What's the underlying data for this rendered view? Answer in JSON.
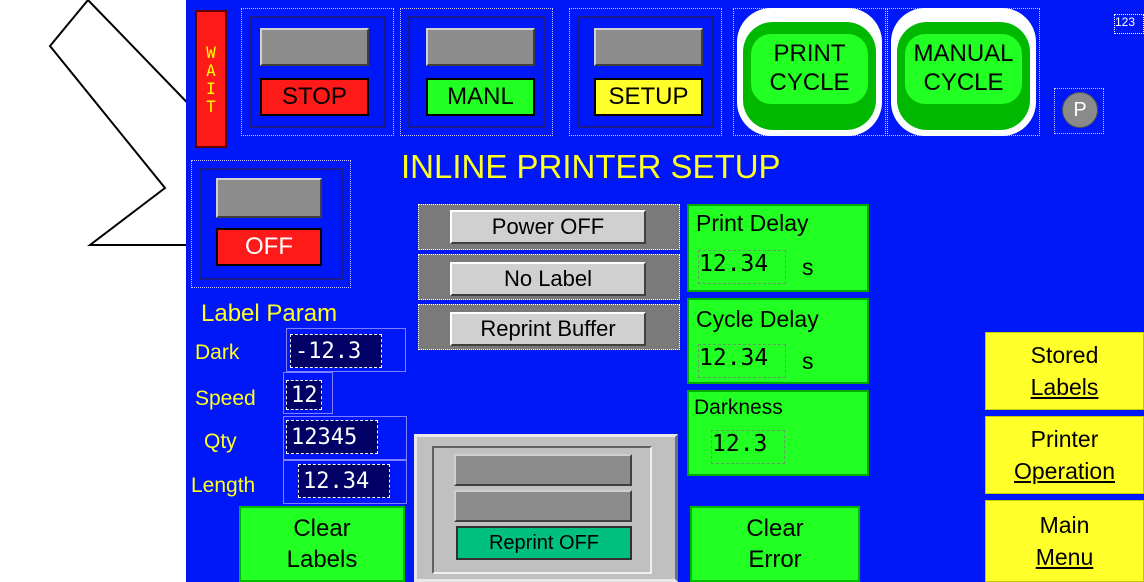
{
  "wait_label": "WAIT",
  "top_buttons": {
    "stop": "STOP",
    "manual": "MANL",
    "setup": "SETUP"
  },
  "print_cycle": {
    "line1": "PRINT",
    "line2": "CYCLE"
  },
  "manual_cycle": {
    "line1": "MANUAL",
    "line2": "CYCLE"
  },
  "p_badge": "P",
  "corner_number": "123",
  "title": "INLINE PRINTER SETUP",
  "off_label": "OFF",
  "buttons": {
    "power": "Power OFF",
    "no_label": "No Label",
    "reprint_buffer": "Reprint Buffer"
  },
  "print_delay": {
    "label": "Print Delay",
    "value": "12.34",
    "unit": "s"
  },
  "cycle_delay": {
    "label": "Cycle Delay",
    "value": "12.34",
    "unit": "s"
  },
  "darkness": {
    "label": "Darkness",
    "value": "12.3"
  },
  "label_param": {
    "title": "Label Param",
    "dark": {
      "label": "Dark",
      "value": "-12.3"
    },
    "speed": {
      "label": "Speed",
      "value": "12"
    },
    "qty": {
      "label": "Qty",
      "value": "12345"
    },
    "length": {
      "label": "Length",
      "value": "12.34"
    }
  },
  "clear_labels": {
    "line1": "Clear",
    "line2": "Labels"
  },
  "clear_error": {
    "line1": "Clear",
    "line2": "Error"
  },
  "reprint_off": "Reprint OFF",
  "side_buttons": {
    "stored": {
      "line1": "Stored",
      "line2": "Labels"
    },
    "printer": {
      "line1": "Printer",
      "line2": "Operation"
    },
    "main": {
      "line1": "Main",
      "line2": "Menu"
    }
  }
}
